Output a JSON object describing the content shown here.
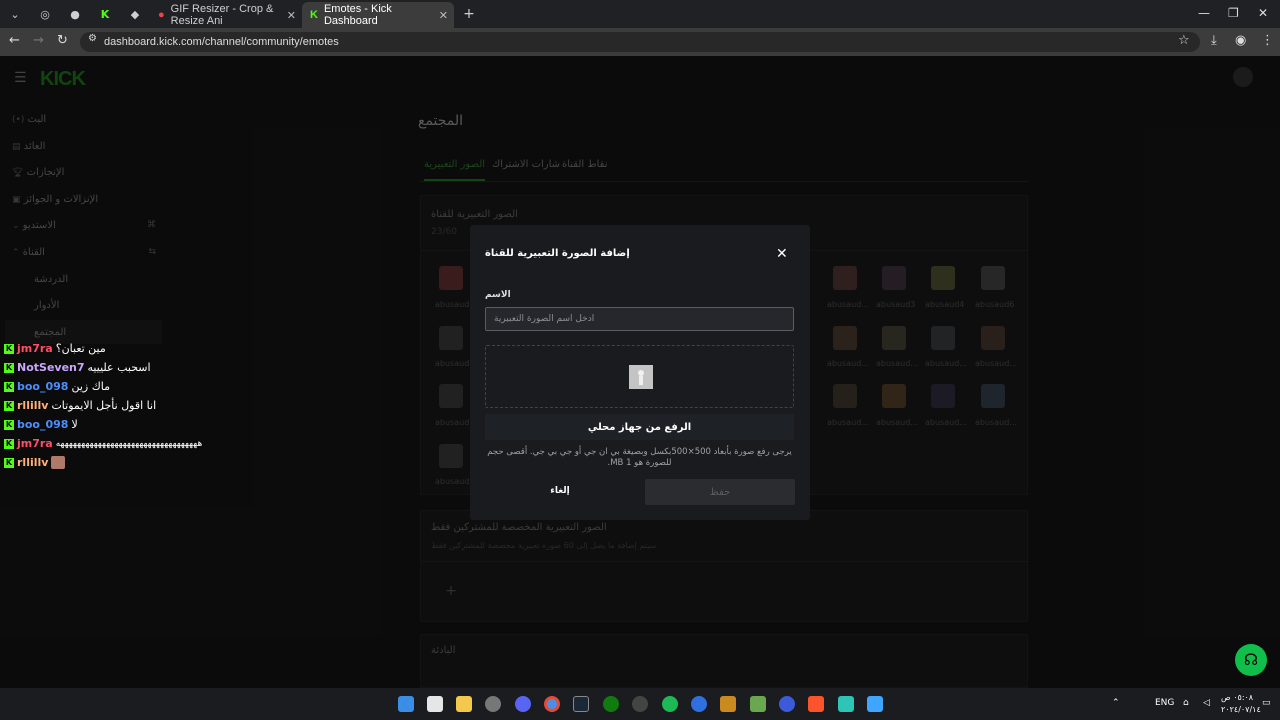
{
  "browser": {
    "tabs": [
      {
        "title": "GIF Resizer - Crop & Resize Ani"
      },
      {
        "title": "Emotes - Kick Dashboard"
      }
    ],
    "url": "dashboard.kick.com/channel/community/emotes"
  },
  "logo": "KICK",
  "sidebar": {
    "items": [
      {
        "label": "البث"
      },
      {
        "label": "العائد"
      },
      {
        "label": "الإنجازات"
      },
      {
        "label": "الإنزالات و الجوائز"
      },
      {
        "label": "الاستديو"
      },
      {
        "label": "القناة"
      },
      {
        "label": "الدردشة"
      },
      {
        "label": "الأدوار"
      },
      {
        "label": "المجتمع"
      }
    ]
  },
  "main": {
    "title": "المجتمع",
    "tabs": [
      {
        "label": "الصور التعبيرية"
      },
      {
        "label": "شارات الاشتراك"
      },
      {
        "label": "نقاط القناة"
      }
    ],
    "emotes_card": {
      "title": "الصور التعبيرية للقناة",
      "count": "23/60",
      "labels": [
        "abusaud3",
        "abusaud4",
        "abusaud6",
        "abusaud...",
        "abusaud...",
        "abusaud..."
      ]
    },
    "sub_card": {
      "title": "الصور التعبيرية المخصصة للمشتركين فقط",
      "subtitle": "سيتم إضافة ما يصل إلى 60 صورة تعبيرية مخصصة للمشتركين فقط",
      "add": "+"
    },
    "bottom_card": {
      "title": "البادئة"
    }
  },
  "chat": [
    {
      "user": "jm7ra",
      "color": "#ff4d6a",
      "msg": "مين تعبان؟"
    },
    {
      "user": "NotSeven7",
      "color": "#c9a7ff",
      "msg": "اسحبب عليييه"
    },
    {
      "user": "boo_098",
      "color": "#4d8eff",
      "msg": "ماك زين"
    },
    {
      "user": "rllillv",
      "color": "#ffb07a",
      "msg": "انا اقول نأجل الايموتات"
    },
    {
      "user": "boo_098",
      "color": "#4d8eff",
      "msg": "لا"
    },
    {
      "user": "jm7ra",
      "color": "#ff4d6a",
      "msg": "ههههههههههههههههههههههههههههههههههه"
    },
    {
      "user": "rllillv",
      "color": "#ffb07a",
      "msg": ""
    }
  ],
  "modal": {
    "title": "إضافة الصورة التعبيرية للقناة",
    "name_label": "الاسم",
    "name_placeholder": "أدخل اسم الصورة التعبيرية",
    "upload_label": "الرفع من جهاز محلي",
    "hint": "يرجى رفع صورة بأبعاد 500×500بكسل وبصيغة بي ان جي أو جي بي جي. أقصى حجم للصورة هو 1 MB.",
    "cancel_label": "إلغاء",
    "save_label": "حفظ"
  },
  "taskbar": {
    "lang": "ENG",
    "time": "٠٥:٠٨ ص",
    "date": "٢٠٢٤/٠٧/١٤"
  },
  "colors": {
    "kick_green": "#53fc18",
    "help_green": "#0fbf4a"
  }
}
